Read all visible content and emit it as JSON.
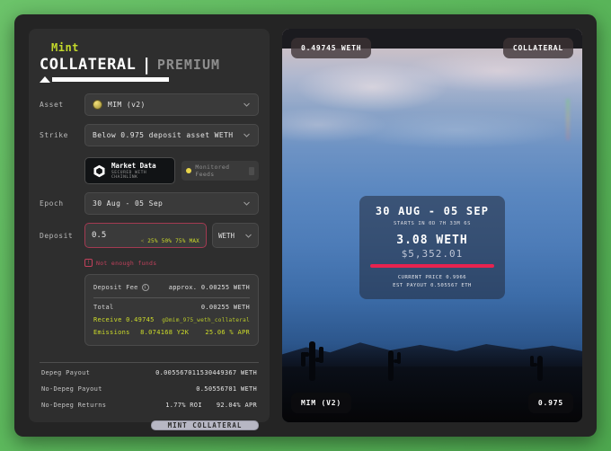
{
  "header": {
    "mint": "Mint",
    "collateral": "COLLATERAL",
    "separator": "|",
    "premium": "PREMIUM"
  },
  "form": {
    "asset": {
      "label": "Asset",
      "value": "MIM (v2)"
    },
    "strike": {
      "label": "Strike",
      "value": "Below 0.975 deposit asset WETH"
    },
    "chainlink": {
      "title": "Market Data",
      "subtitle": "SECURED WITH CHAINLINK",
      "feeds": "Monitored Feeds"
    },
    "epoch": {
      "label": "Epoch",
      "value": "30 Aug - 05 Sep"
    },
    "deposit": {
      "label": "Deposit",
      "value": "0.5",
      "token": "WETH",
      "percents": [
        "25%",
        "50%",
        "75%",
        "MAX"
      ],
      "error": "Not enough funds"
    }
  },
  "fees": {
    "deposit_fee_label": "Deposit Fee",
    "deposit_fee_value": "approx. 0.00255 WETH",
    "total_label": "Total",
    "total_value": "0.00255 WETH",
    "receive_label": "Receive",
    "receive_value": "0.49745",
    "receive_token": "gDmim_975_weth_collateral",
    "emissions_label": "Emissions",
    "emissions_value": "8.074168 Y2K",
    "emissions_apr": "25.06 % APR"
  },
  "stats": [
    {
      "label": "Depeg Payout",
      "value": "0.005567011530449367 WETH"
    },
    {
      "label": "No-Depeg Payout",
      "value": "0.50556701 WETH"
    }
  ],
  "returns": {
    "label": "No-Depeg Returns",
    "roi": "1.77% ROI",
    "apr": "92.04% APR"
  },
  "actions": {
    "mint": "MINT COLLATERAL"
  },
  "card": {
    "tag_amount": "0.49745 WETH",
    "tag_type": "COLLATERAL",
    "tag_asset": "MIM (V2)",
    "tag_strike": "0.975",
    "dates": "30 AUG - 05 SEP",
    "starts_in": "STARTS IN 0D 7H 33M 6S",
    "amount": "3.08 WETH",
    "usd": "$5,352.01",
    "current_price": "CURRENT PRICE 0.9966",
    "est_payout": "EST PAYOUT 0.505567 ETH"
  },
  "colors": {
    "accent": "#cddc2a",
    "error": "#c2415c",
    "bar": "#e8234f"
  }
}
